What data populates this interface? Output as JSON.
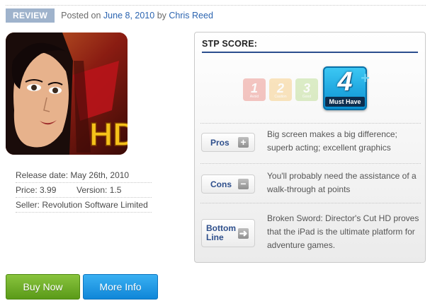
{
  "post": {
    "badge": "REVIEW",
    "posted_prefix": "Posted on",
    "date": "June 8, 2010",
    "by": "by",
    "author": "Chris Reed"
  },
  "app": {
    "icon_text": "HD",
    "release_date": "Release date: May 26th, 2010",
    "price": "Price: 3.99",
    "version": "Version: 1.5",
    "seller": "Seller: Revolution Software Limited"
  },
  "buttons": {
    "buy_now": "Buy Now",
    "more_info": "More Info"
  },
  "score": {
    "title": "STP SCORE:",
    "value": 4,
    "max": 4,
    "levels": [
      {
        "num": "1",
        "caption": "Avoid"
      },
      {
        "num": "2",
        "caption": "Caution"
      },
      {
        "num": "3",
        "caption": "Good"
      },
      {
        "num": "4",
        "caption": "Must Have"
      }
    ]
  },
  "pros": {
    "label": "Pros",
    "icon": "plus-icon",
    "text": "Big screen makes a big difference; superb acting; excellent graphics"
  },
  "cons": {
    "label": "Cons",
    "icon": "minus-icon",
    "text": "You'll probably need the assistance of a walk-through at points"
  },
  "bottom_line": {
    "label_line1": "Bottom",
    "label_line2": "Line",
    "icon": "arrow-right-icon",
    "text": "Broken Sword: Director's Cut HD proves that the iPad is the ultimate platform for adventure games."
  },
  "colors": {
    "link": "#2b64b0",
    "badge": "#9fb3cc",
    "buy": "#6aad2a",
    "info": "#1d9ae4",
    "score_accent": "#2b4e8e"
  }
}
